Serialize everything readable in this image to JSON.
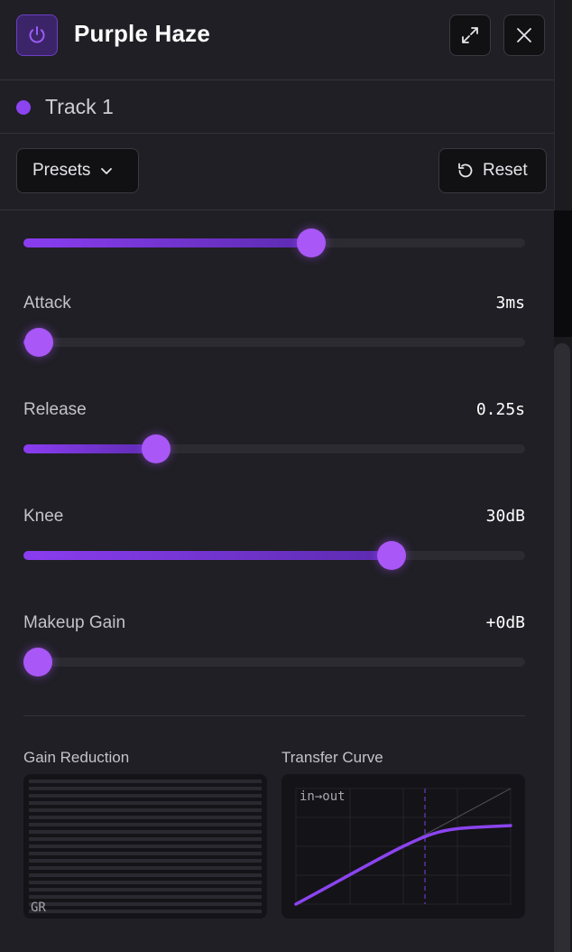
{
  "header": {
    "title": "Purple Haze"
  },
  "track": {
    "name": "Track 1",
    "color": "#8b44f0"
  },
  "toolbar": {
    "presets_label": "Presets",
    "reset_label": "Reset"
  },
  "params": [
    {
      "label": "",
      "value": "",
      "level": 0.573
    },
    {
      "label": "Attack",
      "value": "3ms",
      "level": 0.03
    },
    {
      "label": "Release",
      "value": "0.25s",
      "level": 0.265
    },
    {
      "label": "Knee",
      "value": "30dB",
      "level": 0.734
    },
    {
      "label": "Makeup Gain",
      "value": "+0dB",
      "level": 0.029
    }
  ],
  "meters": {
    "gain_reduction_title": "Gain Reduction",
    "gain_reduction_tag": "GR",
    "transfer_curve_title": "Transfer Curve",
    "transfer_curve_tag": "in→out"
  },
  "colors": {
    "accent": "#8b44f0",
    "thumb": "#a957f6",
    "panel": "#201f25"
  },
  "icons": {
    "power": "power-icon",
    "expand": "expand-icon",
    "close": "close-icon",
    "chevron": "chevron-down-icon",
    "reset": "reset-icon"
  }
}
